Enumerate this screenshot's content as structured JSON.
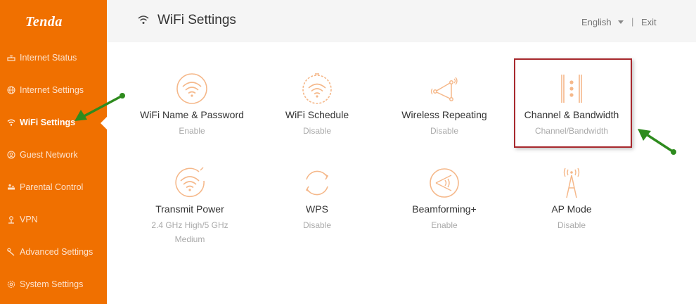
{
  "brand": {
    "logo": "Tenda"
  },
  "sidebar": {
    "items": [
      {
        "label": "Internet Status",
        "icon": "router-icon"
      },
      {
        "label": "Internet Settings",
        "icon": "globe-icon"
      },
      {
        "label": "WiFi Settings",
        "icon": "wifi-icon",
        "active": true
      },
      {
        "label": "Guest Network",
        "icon": "guest-icon"
      },
      {
        "label": "Parental Control",
        "icon": "parental-icon"
      },
      {
        "label": "VPN",
        "icon": "vpn-icon"
      },
      {
        "label": "Advanced Settings",
        "icon": "tools-icon"
      },
      {
        "label": "System Settings",
        "icon": "gear-icon"
      }
    ]
  },
  "header": {
    "title": "WiFi Settings",
    "language": "English",
    "separator": "|",
    "exit": "Exit"
  },
  "tiles": [
    {
      "label": "WiFi Name & Password",
      "status": "Enable"
    },
    {
      "label": "WiFi Schedule",
      "status": "Disable"
    },
    {
      "label": "Wireless Repeating",
      "status": "Disable"
    },
    {
      "label": "Channel & Bandwidth",
      "status": "Channel/Bandwidth"
    },
    {
      "label": "Transmit Power",
      "status": "2.4 GHz High/5 GHz",
      "status2": "Medium"
    },
    {
      "label": "WPS",
      "status": "Disable"
    },
    {
      "label": "Beamforming+",
      "status": "Enable"
    },
    {
      "label": "AP Mode",
      "status": "Disable"
    }
  ],
  "colors": {
    "sidebar": "#f07000",
    "icon": "#f5b88a",
    "highlight": "#a7282d",
    "annotation_arrow": "#2e8b1e"
  }
}
